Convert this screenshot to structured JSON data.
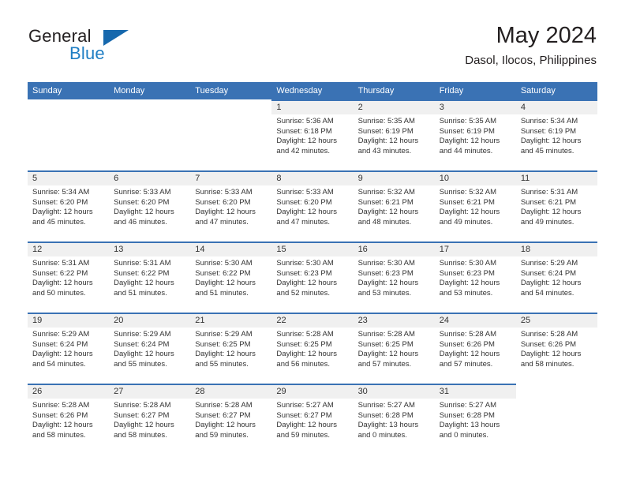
{
  "brand": {
    "name_part1": "General",
    "name_part2": "Blue",
    "logo_icon": "blue-triangle-logo"
  },
  "header": {
    "month_title": "May 2024",
    "location": "Dasol, Ilocos, Philippines"
  },
  "colors": {
    "header_blue": "#3a72b4",
    "brand_blue": "#1f7ec4",
    "day_band_gray": "#f0f0f0",
    "text": "#333333"
  },
  "weekdays": [
    "Sunday",
    "Monday",
    "Tuesday",
    "Wednesday",
    "Thursday",
    "Friday",
    "Saturday"
  ],
  "labels": {
    "sunrise_prefix": "Sunrise:",
    "sunset_prefix": "Sunset:",
    "daylight_prefix": "Daylight:"
  },
  "weeks": [
    [
      {
        "empty": true
      },
      {
        "empty": true
      },
      {
        "empty": true
      },
      {
        "day": "1",
        "sunrise": "Sunrise: 5:36 AM",
        "sunset": "Sunset: 6:18 PM",
        "daylight1": "Daylight: 12 hours",
        "daylight2": "and 42 minutes."
      },
      {
        "day": "2",
        "sunrise": "Sunrise: 5:35 AM",
        "sunset": "Sunset: 6:19 PM",
        "daylight1": "Daylight: 12 hours",
        "daylight2": "and 43 minutes."
      },
      {
        "day": "3",
        "sunrise": "Sunrise: 5:35 AM",
        "sunset": "Sunset: 6:19 PM",
        "daylight1": "Daylight: 12 hours",
        "daylight2": "and 44 minutes."
      },
      {
        "day": "4",
        "sunrise": "Sunrise: 5:34 AM",
        "sunset": "Sunset: 6:19 PM",
        "daylight1": "Daylight: 12 hours",
        "daylight2": "and 45 minutes."
      }
    ],
    [
      {
        "day": "5",
        "sunrise": "Sunrise: 5:34 AM",
        "sunset": "Sunset: 6:20 PM",
        "daylight1": "Daylight: 12 hours",
        "daylight2": "and 45 minutes."
      },
      {
        "day": "6",
        "sunrise": "Sunrise: 5:33 AM",
        "sunset": "Sunset: 6:20 PM",
        "daylight1": "Daylight: 12 hours",
        "daylight2": "and 46 minutes."
      },
      {
        "day": "7",
        "sunrise": "Sunrise: 5:33 AM",
        "sunset": "Sunset: 6:20 PM",
        "daylight1": "Daylight: 12 hours",
        "daylight2": "and 47 minutes."
      },
      {
        "day": "8",
        "sunrise": "Sunrise: 5:33 AM",
        "sunset": "Sunset: 6:20 PM",
        "daylight1": "Daylight: 12 hours",
        "daylight2": "and 47 minutes."
      },
      {
        "day": "9",
        "sunrise": "Sunrise: 5:32 AM",
        "sunset": "Sunset: 6:21 PM",
        "daylight1": "Daylight: 12 hours",
        "daylight2": "and 48 minutes."
      },
      {
        "day": "10",
        "sunrise": "Sunrise: 5:32 AM",
        "sunset": "Sunset: 6:21 PM",
        "daylight1": "Daylight: 12 hours",
        "daylight2": "and 49 minutes."
      },
      {
        "day": "11",
        "sunrise": "Sunrise: 5:31 AM",
        "sunset": "Sunset: 6:21 PM",
        "daylight1": "Daylight: 12 hours",
        "daylight2": "and 49 minutes."
      }
    ],
    [
      {
        "day": "12",
        "sunrise": "Sunrise: 5:31 AM",
        "sunset": "Sunset: 6:22 PM",
        "daylight1": "Daylight: 12 hours",
        "daylight2": "and 50 minutes."
      },
      {
        "day": "13",
        "sunrise": "Sunrise: 5:31 AM",
        "sunset": "Sunset: 6:22 PM",
        "daylight1": "Daylight: 12 hours",
        "daylight2": "and 51 minutes."
      },
      {
        "day": "14",
        "sunrise": "Sunrise: 5:30 AM",
        "sunset": "Sunset: 6:22 PM",
        "daylight1": "Daylight: 12 hours",
        "daylight2": "and 51 minutes."
      },
      {
        "day": "15",
        "sunrise": "Sunrise: 5:30 AM",
        "sunset": "Sunset: 6:23 PM",
        "daylight1": "Daylight: 12 hours",
        "daylight2": "and 52 minutes."
      },
      {
        "day": "16",
        "sunrise": "Sunrise: 5:30 AM",
        "sunset": "Sunset: 6:23 PM",
        "daylight1": "Daylight: 12 hours",
        "daylight2": "and 53 minutes."
      },
      {
        "day": "17",
        "sunrise": "Sunrise: 5:30 AM",
        "sunset": "Sunset: 6:23 PM",
        "daylight1": "Daylight: 12 hours",
        "daylight2": "and 53 minutes."
      },
      {
        "day": "18",
        "sunrise": "Sunrise: 5:29 AM",
        "sunset": "Sunset: 6:24 PM",
        "daylight1": "Daylight: 12 hours",
        "daylight2": "and 54 minutes."
      }
    ],
    [
      {
        "day": "19",
        "sunrise": "Sunrise: 5:29 AM",
        "sunset": "Sunset: 6:24 PM",
        "daylight1": "Daylight: 12 hours",
        "daylight2": "and 54 minutes."
      },
      {
        "day": "20",
        "sunrise": "Sunrise: 5:29 AM",
        "sunset": "Sunset: 6:24 PM",
        "daylight1": "Daylight: 12 hours",
        "daylight2": "and 55 minutes."
      },
      {
        "day": "21",
        "sunrise": "Sunrise: 5:29 AM",
        "sunset": "Sunset: 6:25 PM",
        "daylight1": "Daylight: 12 hours",
        "daylight2": "and 55 minutes."
      },
      {
        "day": "22",
        "sunrise": "Sunrise: 5:28 AM",
        "sunset": "Sunset: 6:25 PM",
        "daylight1": "Daylight: 12 hours",
        "daylight2": "and 56 minutes."
      },
      {
        "day": "23",
        "sunrise": "Sunrise: 5:28 AM",
        "sunset": "Sunset: 6:25 PM",
        "daylight1": "Daylight: 12 hours",
        "daylight2": "and 57 minutes."
      },
      {
        "day": "24",
        "sunrise": "Sunrise: 5:28 AM",
        "sunset": "Sunset: 6:26 PM",
        "daylight1": "Daylight: 12 hours",
        "daylight2": "and 57 minutes."
      },
      {
        "day": "25",
        "sunrise": "Sunrise: 5:28 AM",
        "sunset": "Sunset: 6:26 PM",
        "daylight1": "Daylight: 12 hours",
        "daylight2": "and 58 minutes."
      }
    ],
    [
      {
        "day": "26",
        "sunrise": "Sunrise: 5:28 AM",
        "sunset": "Sunset: 6:26 PM",
        "daylight1": "Daylight: 12 hours",
        "daylight2": "and 58 minutes."
      },
      {
        "day": "27",
        "sunrise": "Sunrise: 5:28 AM",
        "sunset": "Sunset: 6:27 PM",
        "daylight1": "Daylight: 12 hours",
        "daylight2": "and 58 minutes."
      },
      {
        "day": "28",
        "sunrise": "Sunrise: 5:28 AM",
        "sunset": "Sunset: 6:27 PM",
        "daylight1": "Daylight: 12 hours",
        "daylight2": "and 59 minutes."
      },
      {
        "day": "29",
        "sunrise": "Sunrise: 5:27 AM",
        "sunset": "Sunset: 6:27 PM",
        "daylight1": "Daylight: 12 hours",
        "daylight2": "and 59 minutes."
      },
      {
        "day": "30",
        "sunrise": "Sunrise: 5:27 AM",
        "sunset": "Sunset: 6:28 PM",
        "daylight1": "Daylight: 13 hours",
        "daylight2": "and 0 minutes."
      },
      {
        "day": "31",
        "sunrise": "Sunrise: 5:27 AM",
        "sunset": "Sunset: 6:28 PM",
        "daylight1": "Daylight: 13 hours",
        "daylight2": "and 0 minutes."
      },
      {
        "empty": true
      }
    ]
  ]
}
